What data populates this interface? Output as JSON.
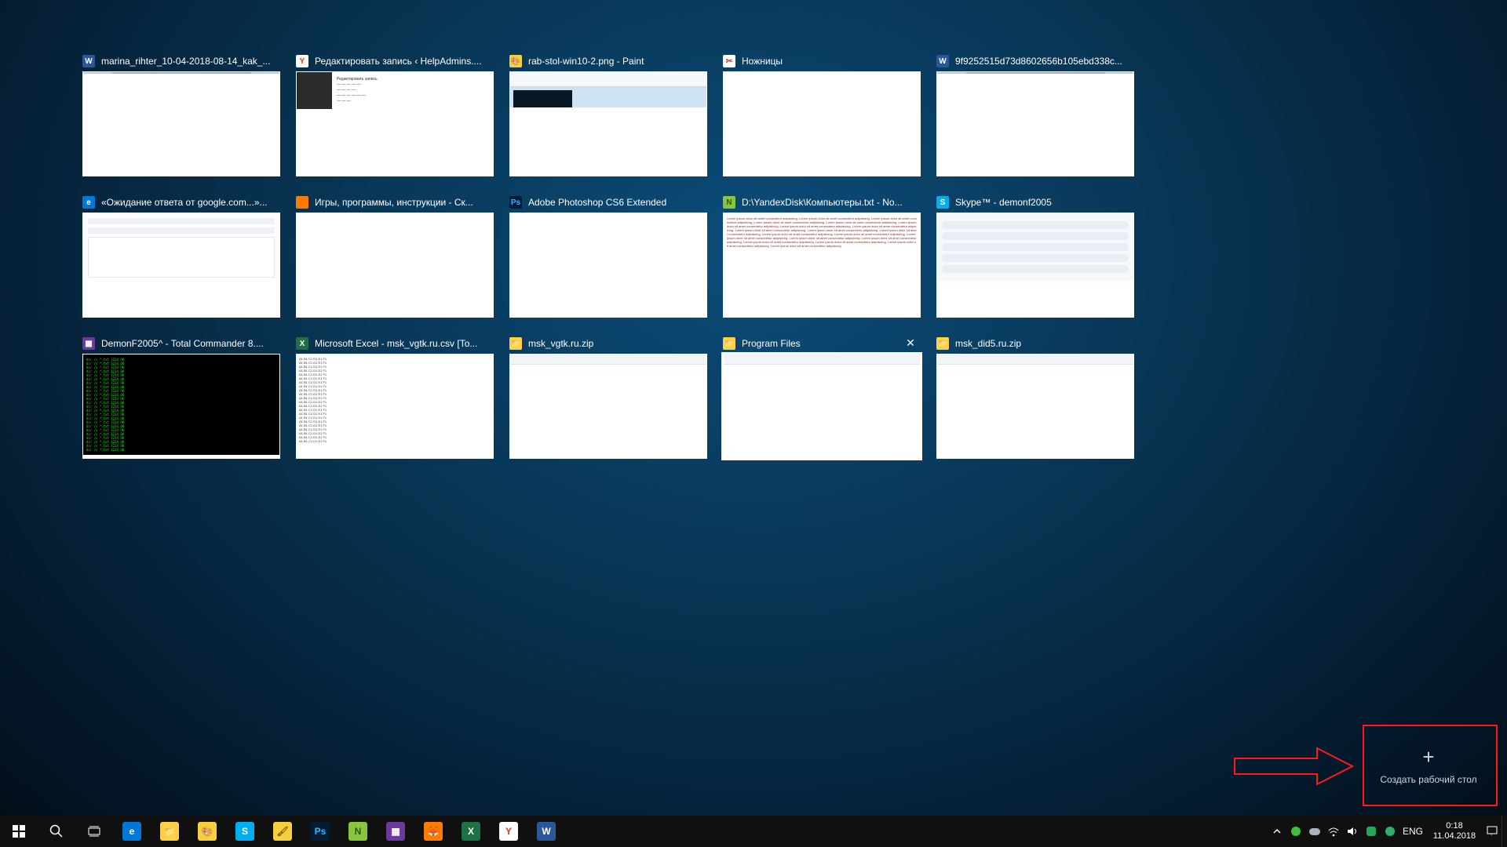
{
  "windows_row1": [
    {
      "title": "marina_rihter_10-04-2018-08-14_kak_...",
      "icon": "word",
      "icon_bg": "#2a579a",
      "icon_fg": "#fff",
      "icon_txt": "W",
      "pv": "word"
    },
    {
      "title": "Редактировать запись ‹ HelpAdmins....",
      "icon": "yandex",
      "icon_bg": "#fff",
      "icon_fg": "#d33",
      "icon_txt": "Y",
      "pv": "yandex"
    },
    {
      "title": "rab-stol-win10-2.png - Paint",
      "icon": "paint",
      "icon_bg": "#f4d03f",
      "icon_fg": "#8a4a00",
      "icon_txt": "🎨",
      "pv": "paint"
    },
    {
      "title": "Ножницы",
      "icon": "snipping",
      "icon_bg": "#ffffff",
      "icon_fg": "#d03030",
      "icon_txt": "✂",
      "pv": "snip"
    },
    {
      "title": "9f9252515d73d8602656b105ebd338c...",
      "icon": "word",
      "icon_bg": "#2a579a",
      "icon_fg": "#fff",
      "icon_txt": "W",
      "pv": "word2"
    }
  ],
  "windows_row2": [
    {
      "title": "«Ожидание ответа от google.com...»...",
      "icon": "edge",
      "icon_bg": "#0078d7",
      "icon_fg": "#fff",
      "icon_txt": "e",
      "pv": "edge"
    },
    {
      "title": "Игры, программы, инструкции - Ск...",
      "icon": "firefox",
      "icon_bg": "#ff7b00",
      "icon_fg": "#fff",
      "icon_txt": "",
      "pv": "firefox"
    },
    {
      "title": "Adobe Photoshop CS6 Extended",
      "icon": "photoshop",
      "icon_bg": "#001d34",
      "icon_fg": "#34b4ff",
      "icon_txt": "Ps",
      "pv": "ps"
    },
    {
      "title": "D:\\YandexDisk\\Компьютеры.txt - No...",
      "icon": "notepadpp",
      "icon_bg": "#89c53f",
      "icon_fg": "#2d5a00",
      "icon_txt": "N",
      "pv": "npp"
    },
    {
      "title": "Skype™ - demonf2005",
      "icon": "skype",
      "icon_bg": "#00aff0",
      "icon_fg": "#fff",
      "icon_txt": "S",
      "pv": "skype"
    }
  ],
  "windows_row3": [
    {
      "title": "DemonF2005^ - Total Commander 8....",
      "icon": "totalcmd",
      "icon_bg": "#6b3a9c",
      "icon_fg": "#fff",
      "icon_txt": "▦",
      "pv": "tc"
    },
    {
      "title": "Microsoft Excel - msk_vgtk.ru.csv  [To...",
      "icon": "excel",
      "icon_bg": "#1e7145",
      "icon_fg": "#fff",
      "icon_txt": "X",
      "pv": "xl"
    },
    {
      "title": "msk_vgtk.ru.zip",
      "icon": "folder",
      "icon_bg": "#ffcf48",
      "icon_fg": "#a06a00",
      "icon_txt": "📁",
      "pv": "folder"
    },
    {
      "title": "Program Files",
      "icon": "folder",
      "icon_bg": "#ffcf48",
      "icon_fg": "#a06a00",
      "icon_txt": "📁",
      "pv": "folder",
      "selected": true
    },
    {
      "title": "msk_did5.ru.zip",
      "icon": "folder",
      "icon_bg": "#ffcf48",
      "icon_fg": "#a06a00",
      "icon_txt": "📁",
      "pv": "folder"
    }
  ],
  "new_desktop_label": "Создать рабочий стол",
  "taskbar_apps": [
    {
      "name": "edge",
      "bg": "#0078d7",
      "fg": "#fff",
      "txt": "e"
    },
    {
      "name": "explorer",
      "bg": "#ffcf48",
      "fg": "#a06a00",
      "txt": "📁"
    },
    {
      "name": "paint",
      "bg": "#f4d03f",
      "fg": "#8a4a00",
      "txt": "🎨"
    },
    {
      "name": "skype",
      "bg": "#00aff0",
      "fg": "#fff",
      "txt": "S"
    },
    {
      "name": "paint2",
      "bg": "#f4d03f",
      "fg": "#8a4a00",
      "txt": "🖌"
    },
    {
      "name": "photoshop",
      "bg": "#001d34",
      "fg": "#34b4ff",
      "txt": "Ps"
    },
    {
      "name": "notepadpp",
      "bg": "#89c53f",
      "fg": "#2d5a00",
      "txt": "N"
    },
    {
      "name": "totalcmd",
      "bg": "#6b3a9c",
      "fg": "#fff",
      "txt": "▦"
    },
    {
      "name": "firefox",
      "bg": "#ff7b00",
      "fg": "#fff",
      "txt": "🦊"
    },
    {
      "name": "excel",
      "bg": "#1e7145",
      "fg": "#fff",
      "txt": "X"
    },
    {
      "name": "yandex",
      "bg": "#ffffff",
      "fg": "#d33",
      "txt": "Y"
    },
    {
      "name": "word",
      "bg": "#2a579a",
      "fg": "#fff",
      "txt": "W"
    }
  ],
  "tray": {
    "lang": "ENG",
    "time": "0:18",
    "date": "11.04.2018"
  }
}
